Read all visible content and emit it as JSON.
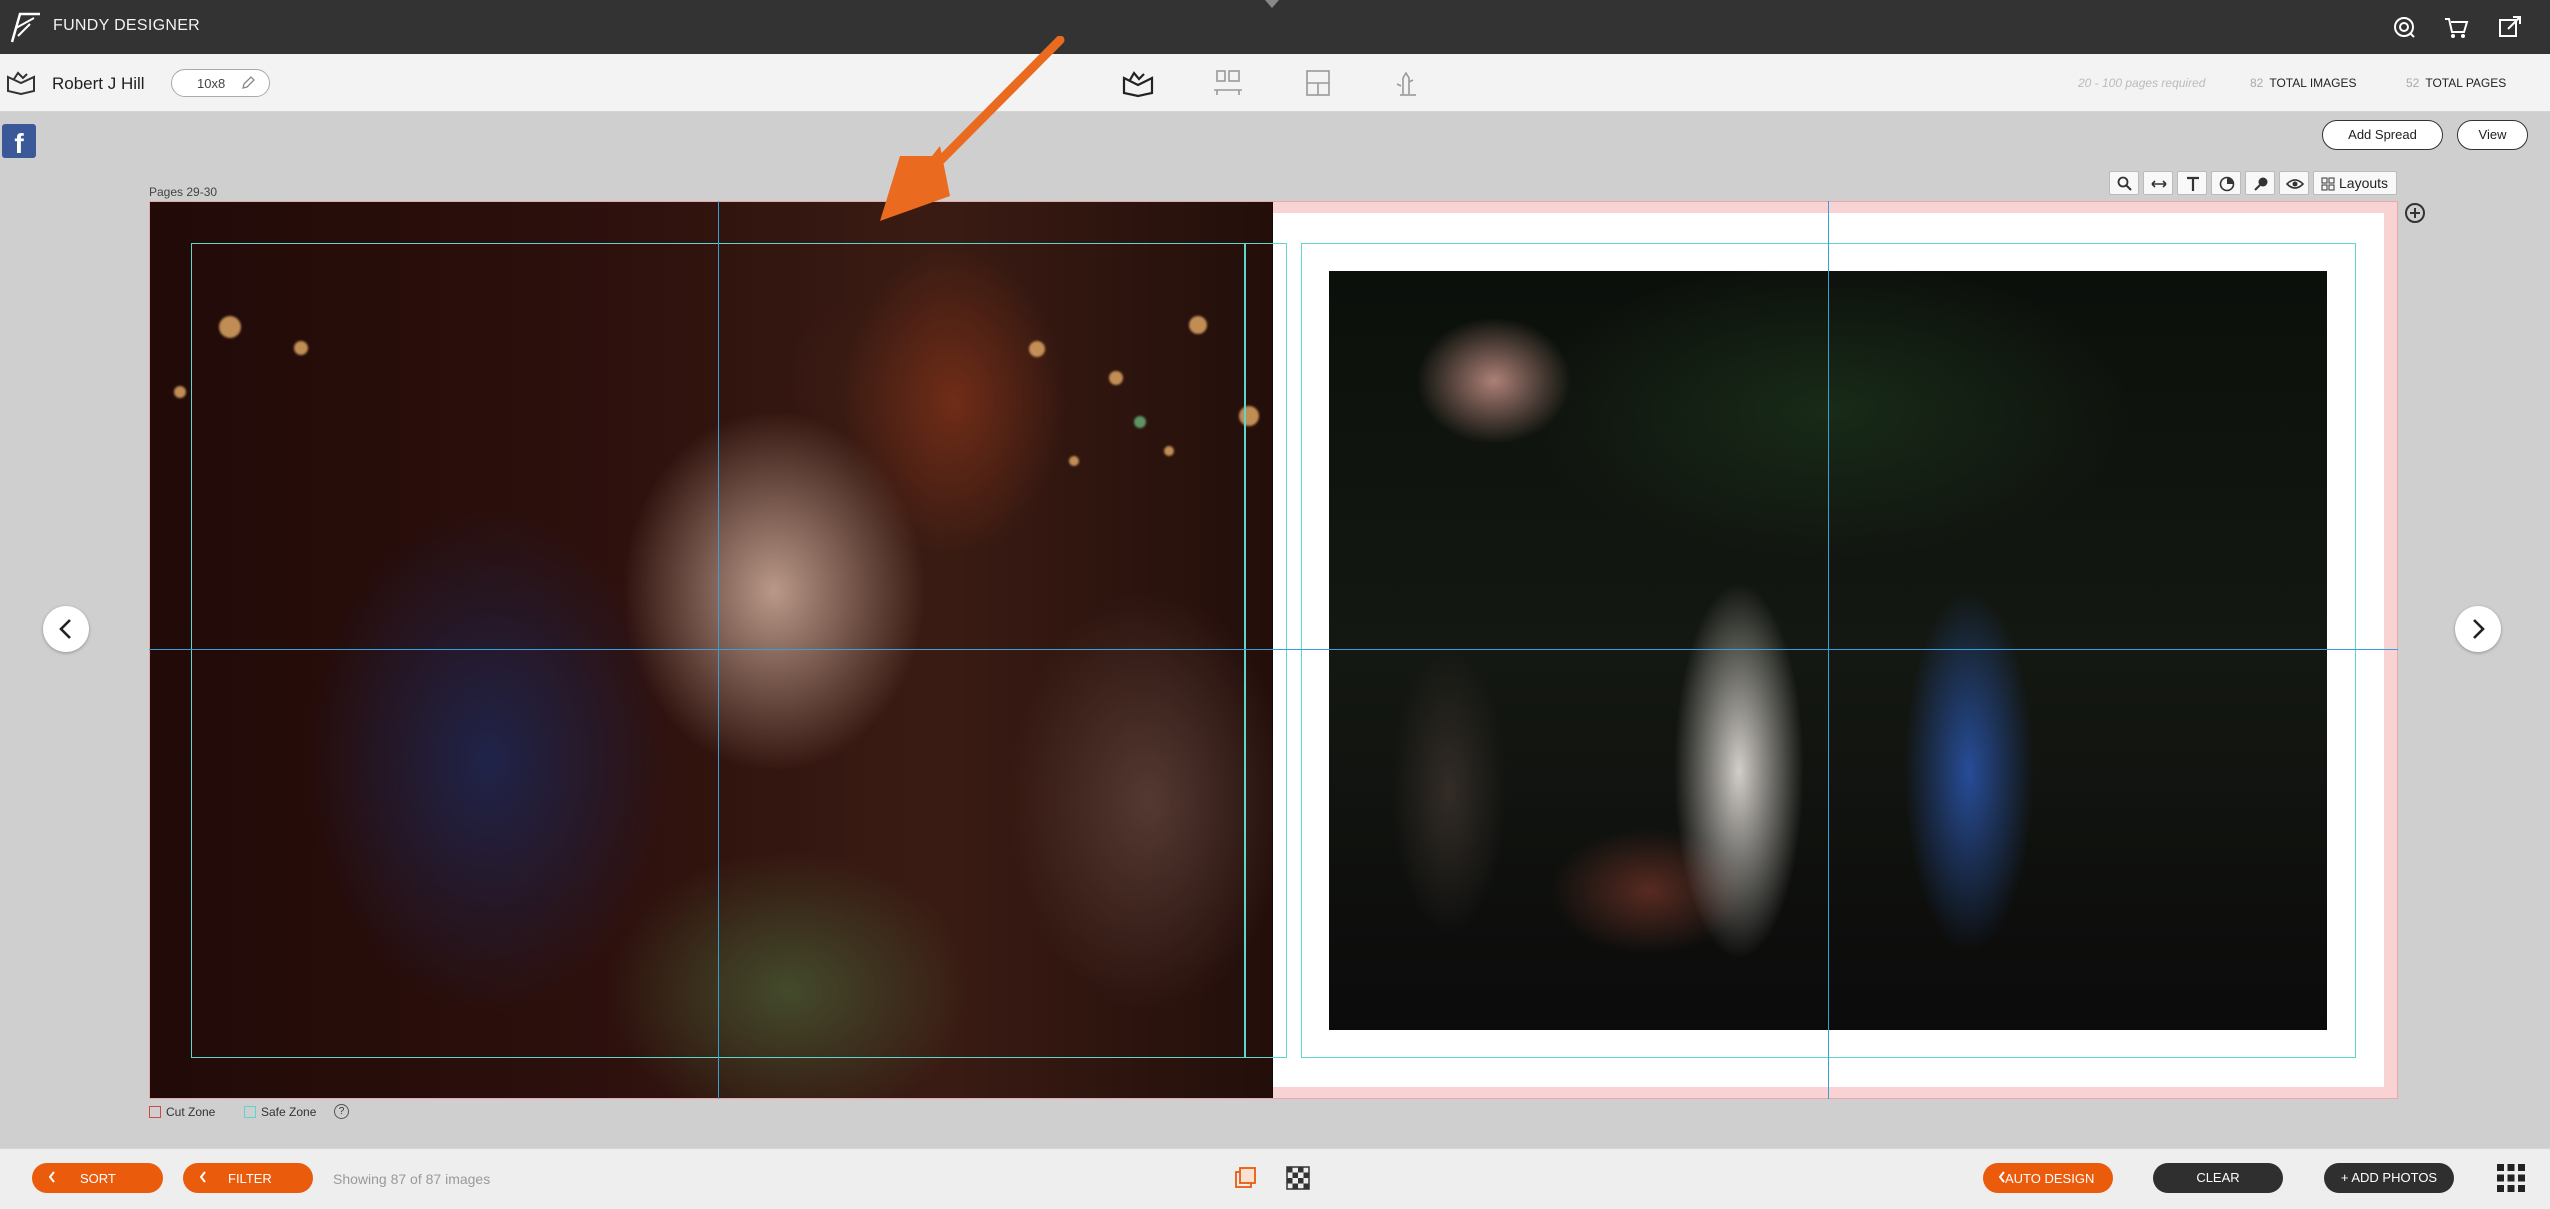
{
  "app": {
    "title": "FUNDY DESIGNER"
  },
  "topbar": {
    "icons": [
      "support-icon",
      "cart-icon",
      "external-link-icon"
    ]
  },
  "project": {
    "client_name": "Robert J Hill",
    "album_size": "10x8",
    "pages_required": "20 - 100 pages required",
    "total_images_count": "82",
    "total_images_label": "TOTAL IMAGES",
    "total_pages_count": "52",
    "total_pages_label": "TOTAL PAGES",
    "modes": [
      "album-design-icon",
      "wall-art-icon",
      "card-icon",
      "proof-hand-icon"
    ]
  },
  "actions": {
    "add_spread": "Add Spread",
    "view": "View"
  },
  "spread": {
    "label": "Pages 29-30"
  },
  "toolbar": {
    "tools": [
      "zoom-icon",
      "fit-width-icon",
      "text-icon",
      "color-icon",
      "pin-icon",
      "eye-icon"
    ],
    "layouts_label": "Layouts"
  },
  "legend": {
    "cut_zone": "Cut Zone",
    "safe_zone": "Safe Zone",
    "help": "?"
  },
  "bottom": {
    "sort": "SORT",
    "filter": "FILTER",
    "showing": "Showing 87 of 87 images",
    "auto_design": "AUTO DESIGN",
    "clear": "CLEAR",
    "add_photos": "+ ADD PHOTOS"
  },
  "colors": {
    "accent": "#ea5b0c",
    "topbar": "#333333",
    "safe_zone": "#5fd6cc",
    "cut_zone": "#e7a9a9",
    "guide": "#3a9fd6",
    "annotation_arrow": "#ea6a1f"
  }
}
